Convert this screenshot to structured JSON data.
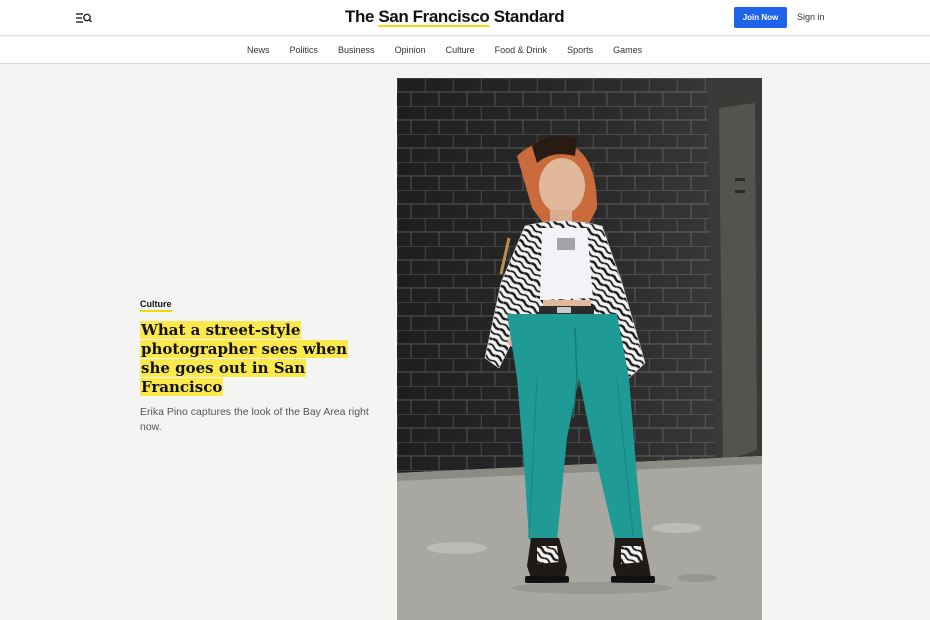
{
  "header": {
    "brand_prefix": "The ",
    "brand_highlight": "San Francisco",
    "brand_suffix": " Standard",
    "join_label": "Join Now",
    "signin_label": "Sign in",
    "menu_icon": "menu-search-icon"
  },
  "nav": {
    "items": [
      "News",
      "Politics",
      "Business",
      "Opinion",
      "Culture",
      "Food & Drink",
      "Sports",
      "Games"
    ]
  },
  "story": {
    "kicker": "Culture",
    "headline": "What a street-style photographer sees when she goes out in San Francisco",
    "dek": "Erika Pino captures the look of the Bay Area right now."
  },
  "colors": {
    "accent_yellow": "#fbe84a",
    "button_blue": "#1e63e9",
    "page_bg": "#f4f4f2"
  }
}
